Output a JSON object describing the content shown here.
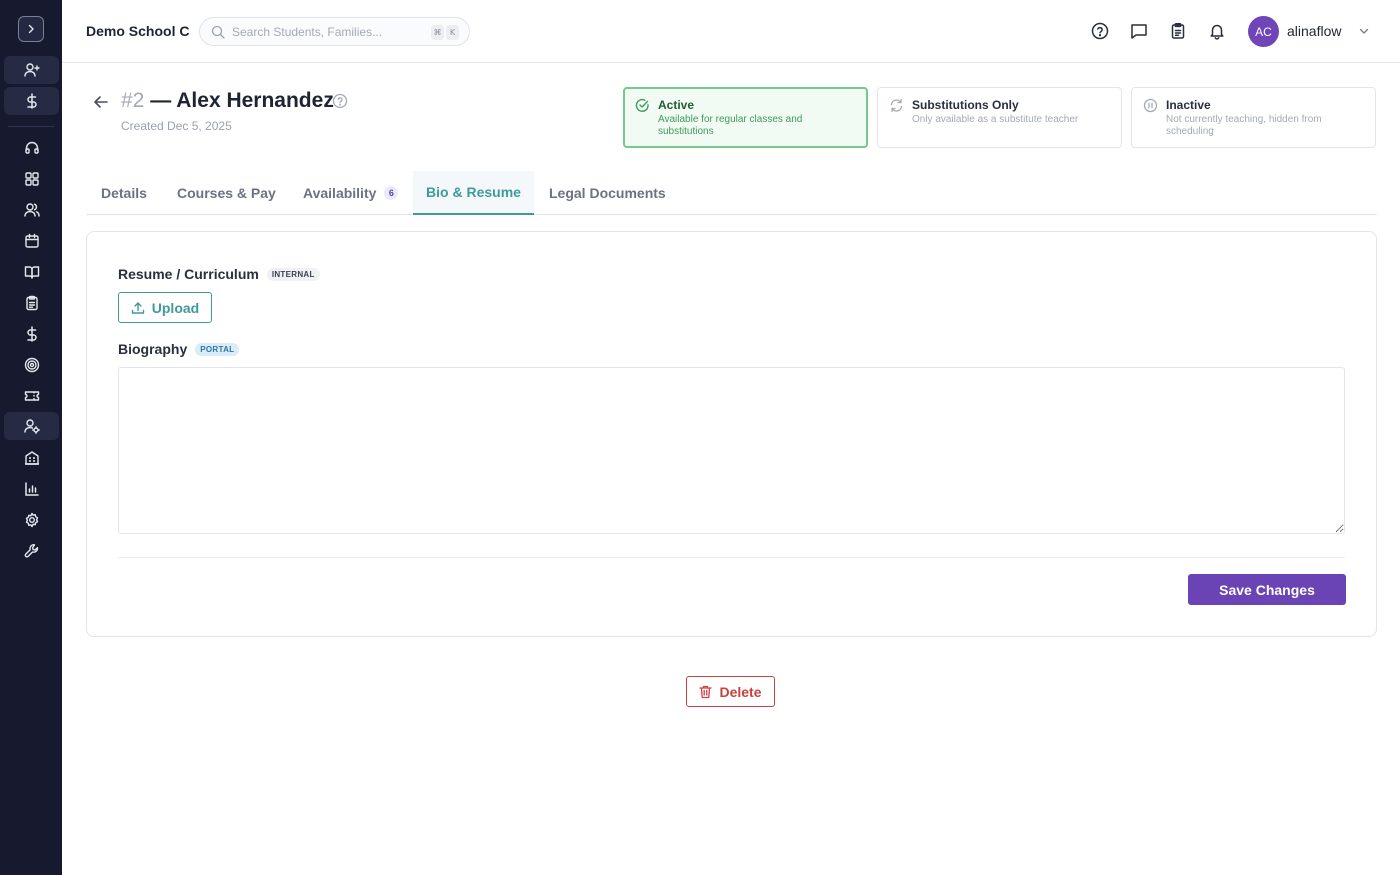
{
  "sidebar": {
    "toggle_icon": "chevron-right-icon",
    "items": [
      {
        "icon": "user-plus-icon",
        "highlight": true
      },
      {
        "icon": "dollar-icon",
        "highlight": true
      },
      {
        "icon": "headset-icon",
        "highlight": false
      },
      {
        "icon": "grid-icon",
        "highlight": false
      },
      {
        "icon": "users-icon",
        "highlight": false
      },
      {
        "icon": "calendar-icon",
        "highlight": false
      },
      {
        "icon": "book-icon",
        "highlight": false
      },
      {
        "icon": "clipboard-icon",
        "highlight": false
      },
      {
        "icon": "dollar-icon",
        "highlight": false
      },
      {
        "icon": "target-icon",
        "highlight": false
      },
      {
        "icon": "ticket-icon",
        "highlight": false
      },
      {
        "icon": "user-gear-icon",
        "highlight": true
      },
      {
        "icon": "building-icon",
        "highlight": false
      },
      {
        "icon": "bar-chart-icon",
        "highlight": false
      },
      {
        "icon": "settings-icon",
        "highlight": false
      },
      {
        "icon": "wrench-icon",
        "highlight": false
      }
    ]
  },
  "header": {
    "school_name": "Demo School C",
    "search_placeholder": "Search Students, Families...",
    "shortcut_keys": [
      "⌘",
      "K"
    ],
    "icons": [
      "help-icon",
      "message-icon",
      "clipboard-icon",
      "bell-icon"
    ],
    "user": {
      "initials": "AC",
      "name": "alinaflow"
    }
  },
  "profile": {
    "number": "#2",
    "separator": "—",
    "name": "Alex Hernandez",
    "created": "Created Dec 5, 2025"
  },
  "statuses": [
    {
      "title": "Active",
      "description": "Available for regular classes and substitutions",
      "selected": true,
      "icon": "check-circle-icon"
    },
    {
      "title": "Substitutions Only",
      "description": "Only available as a substitute teacher",
      "selected": false,
      "icon": "refresh-icon"
    },
    {
      "title": "Inactive",
      "description": "Not currently teaching, hidden from scheduling",
      "selected": false,
      "icon": "pause-circle-icon"
    }
  ],
  "tabs": [
    {
      "label": "Details",
      "active": false
    },
    {
      "label": "Courses & Pay",
      "active": false
    },
    {
      "label": "Availability",
      "badge": "6",
      "active": false
    },
    {
      "label": "Bio & Resume",
      "active": true
    },
    {
      "label": "Legal Documents",
      "active": false
    }
  ],
  "bio_panel": {
    "resume_label": "Resume / Curriculum",
    "resume_chip": "INTERNAL",
    "upload_label": "Upload",
    "biography_label": "Biography",
    "biography_chip": "PORTAL",
    "biography_value": "",
    "save_label": "Save Changes"
  },
  "delete_label": "Delete",
  "colors": {
    "sidebar_bg": "#171a2e",
    "accent_teal": "#3f9b9a",
    "primary_purple": "#6a44b5",
    "active_green": "#74c98c",
    "danger_red": "#c9423d"
  }
}
